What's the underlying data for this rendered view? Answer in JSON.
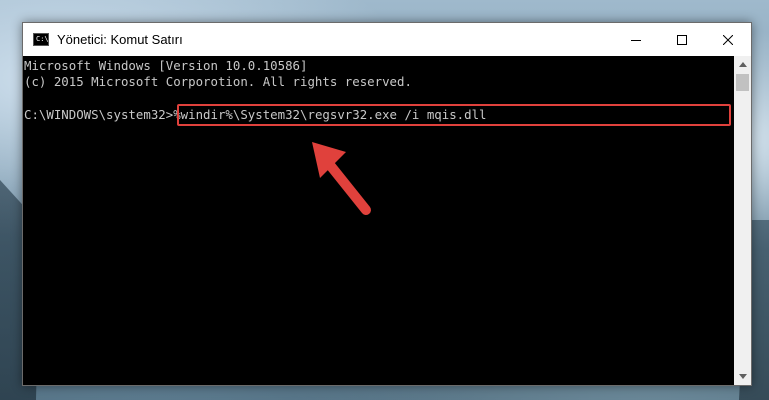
{
  "window": {
    "title": "Yönetici: Komut Satırı",
    "icon": "cmd-icon",
    "controls": [
      "minimize-icon",
      "maximize-icon",
      "close-icon"
    ]
  },
  "console": {
    "line1": "Microsoft Windows [Version 10.0.10586]",
    "line2": "(c) 2015 Microsoft Corporotion. All rights reserved.",
    "prompt": "C:\\WINDOWS\\system32>",
    "command": "%windir%\\System32\\regsvr32.exe /i mqis.dll"
  },
  "annotation": {
    "highlight_color": "#e0413c",
    "arrow_icon": "red-arrow-icon"
  },
  "colors": {
    "console_bg": "#000000",
    "console_text": "#c8c8c8",
    "titlebar_bg": "#ffffff"
  }
}
